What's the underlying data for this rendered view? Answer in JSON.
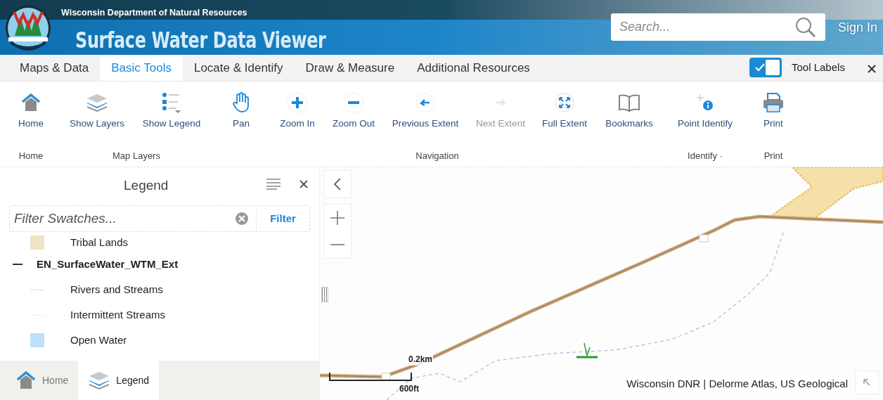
{
  "header": {
    "agency": "Wisconsin Department of Natural Resources",
    "title": "Surface Water Data Viewer",
    "search": {
      "placeholder": "Search..."
    },
    "sign_in": "Sign In"
  },
  "tabs": [
    {
      "label": "Maps & Data",
      "selected": false
    },
    {
      "label": "Basic Tools",
      "selected": true
    },
    {
      "label": "Locate & Identify",
      "selected": false
    },
    {
      "label": "Draw & Measure",
      "selected": false
    },
    {
      "label": "Additional Resources",
      "selected": false
    }
  ],
  "tool_labels_toggle": {
    "label": "Tool Labels",
    "on": true
  },
  "tool_groups": [
    {
      "label": "Home",
      "tools": [
        {
          "label": "Home",
          "kind": "home",
          "disabled": false
        }
      ]
    },
    {
      "label": "Map Layers",
      "tools": [
        {
          "label": "Show Layers",
          "kind": "layers",
          "disabled": false
        },
        {
          "label": "Show Legend",
          "kind": "legend",
          "disabled": false
        }
      ]
    },
    {
      "label": "Navigation",
      "tools": [
        {
          "label": "Pan",
          "kind": "pan",
          "disabled": false
        },
        {
          "label": "Zoom In",
          "kind": "zoomin",
          "disabled": false
        },
        {
          "label": "Zoom Out",
          "kind": "zoomout",
          "disabled": false
        },
        {
          "label": "Previous Extent",
          "kind": "prev",
          "disabled": false
        },
        {
          "label": "Next Extent",
          "kind": "next",
          "disabled": true
        },
        {
          "label": "Full Extent",
          "kind": "full",
          "disabled": false
        },
        {
          "label": "Bookmarks",
          "kind": "book",
          "disabled": false
        }
      ]
    },
    {
      "label": "Identify ·",
      "tools": [
        {
          "label": "Point Identify",
          "kind": "identify",
          "disabled": false
        }
      ]
    },
    {
      "label": "Print",
      "tools": [
        {
          "label": "Print",
          "kind": "print",
          "disabled": false
        }
      ]
    }
  ],
  "legend_panel": {
    "title": "Legend",
    "filter": {
      "placeholder": "Filter Swatches...",
      "button": "Filter"
    },
    "items": [
      {
        "label": "Tribal Lands",
        "kind": "fill",
        "color": "#efe3c4"
      },
      {
        "label": "EN_SurfaceWater_WTM_Ext",
        "kind": "group",
        "expanded": true,
        "children": [
          {
            "label": "Rivers and Streams",
            "kind": "line",
            "color": "#dddddd"
          },
          {
            "label": "Intermittent Streams",
            "kind": "line",
            "color": "#eeeeee"
          },
          {
            "label": "Open Water",
            "kind": "fill",
            "color": "#bfe0f7"
          }
        ]
      }
    ],
    "bottom_tabs": [
      {
        "label": "Home",
        "kind": "home",
        "selected": false
      },
      {
        "label": "Legend",
        "kind": "layers",
        "selected": true
      }
    ]
  },
  "map": {
    "kind": "picture",
    "scale_bar": {
      "metric": "0.2km",
      "imperial": "600ft"
    },
    "attribution": "Wisconsin DNR | Delorme Atlas, US Geological"
  }
}
